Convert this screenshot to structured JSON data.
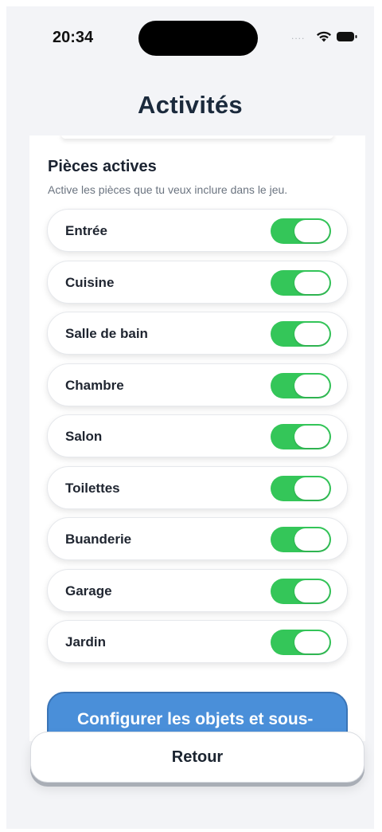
{
  "status_bar": {
    "time": "20:34",
    "signal": "....",
    "wifi_icon": "wifi-icon",
    "battery_icon": "battery-icon"
  },
  "page": {
    "title": "Activités"
  },
  "section": {
    "title": "Pièces actives",
    "subtitle": "Active les pièces que tu veux inclure dans le jeu."
  },
  "rooms": [
    {
      "label": "Entrée",
      "enabled": true
    },
    {
      "label": "Cuisine",
      "enabled": true
    },
    {
      "label": "Salle de bain",
      "enabled": true
    },
    {
      "label": "Chambre",
      "enabled": true
    },
    {
      "label": "Salon",
      "enabled": true
    },
    {
      "label": "Toilettes",
      "enabled": true
    },
    {
      "label": "Buanderie",
      "enabled": true
    },
    {
      "label": "Garage",
      "enabled": true
    },
    {
      "label": "Jardin",
      "enabled": true
    }
  ],
  "config_button": {
    "label": "Configurer les objets et sous-emplacements"
  },
  "back_button": {
    "label": "Retour"
  },
  "colors": {
    "toggle_on": "#34c659",
    "config_bg": "#4a8fd9",
    "title": "#1b2a3c"
  }
}
